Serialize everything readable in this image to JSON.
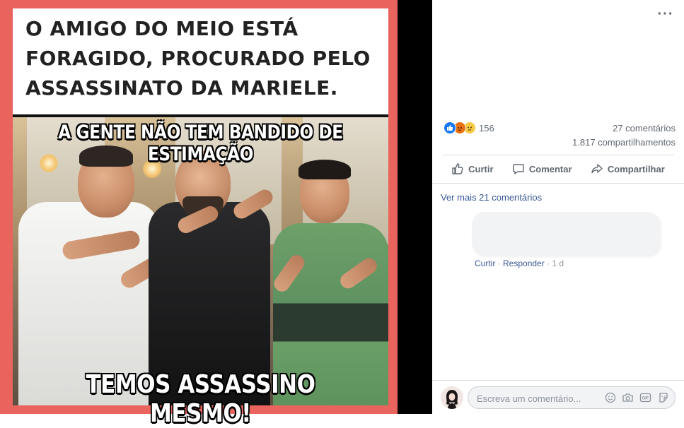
{
  "meme": {
    "top_text": "O AMIGO DO MEIO ESTÁ FORAGIDO, PROCURADO PELO ASSASSINATO DA MARIELE.",
    "middle_caption": "A GENTE NÃO TEM BANDIDO DE ESTIMAÇÃO",
    "bottom_caption": "TEMOS ASSASSINO MESMO!"
  },
  "post": {
    "reactions": {
      "icons": [
        "like-icon",
        "angry-icon",
        "sad-icon"
      ],
      "count": "156"
    },
    "comments_count": "27 comentários",
    "shares_count": "1.817 compartilhamentos",
    "actions": {
      "like": "Curtir",
      "comment": "Comentar",
      "share": "Compartilhar"
    },
    "see_more": "Ver mais 21 comentários",
    "comment_meta": {
      "like": "Curtir",
      "sep1": " · ",
      "reply": "Responder",
      "sep2": " · ",
      "time": "1 d"
    },
    "comment_input": {
      "placeholder": "Escreva um comentário..."
    }
  },
  "colors": {
    "meme_border": "#e8645d",
    "link": "#385898",
    "like_blue": "#1877f2"
  }
}
